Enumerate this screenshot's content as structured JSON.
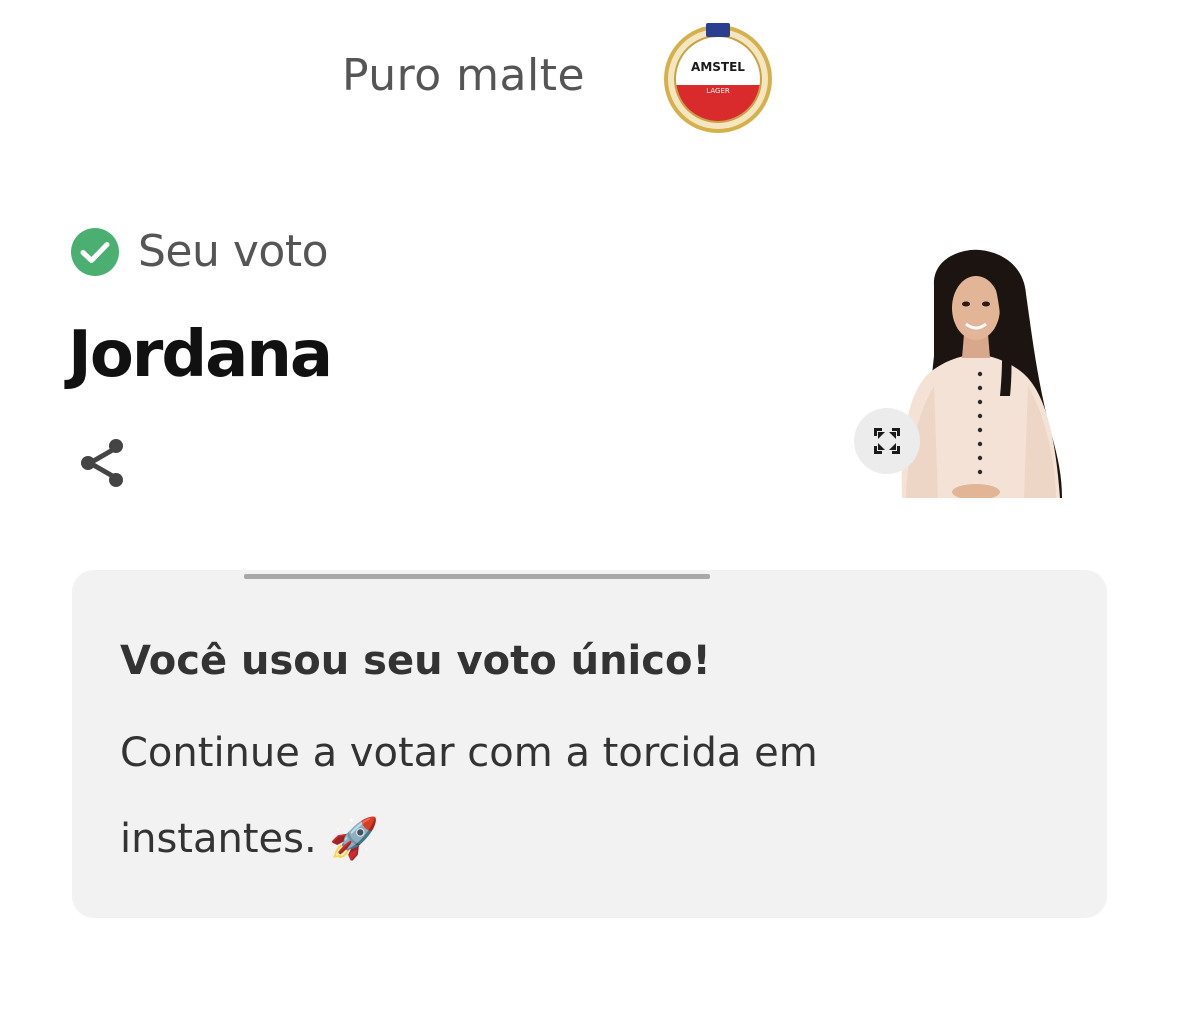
{
  "sponsor": {
    "text": "Puro malte",
    "logo_name": "amstel-lager-logo",
    "logo_text": "AMSTEL",
    "logo_subtext": "LAGER"
  },
  "vote": {
    "status_label": "Seu voto",
    "candidate_name": "Jordana",
    "status_color": "#4CAF72"
  },
  "icons": {
    "check": "check-circle-icon",
    "share": "share-icon",
    "expand": "expand-icon"
  },
  "card": {
    "title": "Você usou seu voto único!",
    "body": "Continue a votar com a torcida em instantes. 🚀",
    "background": "#f2f2f2"
  }
}
